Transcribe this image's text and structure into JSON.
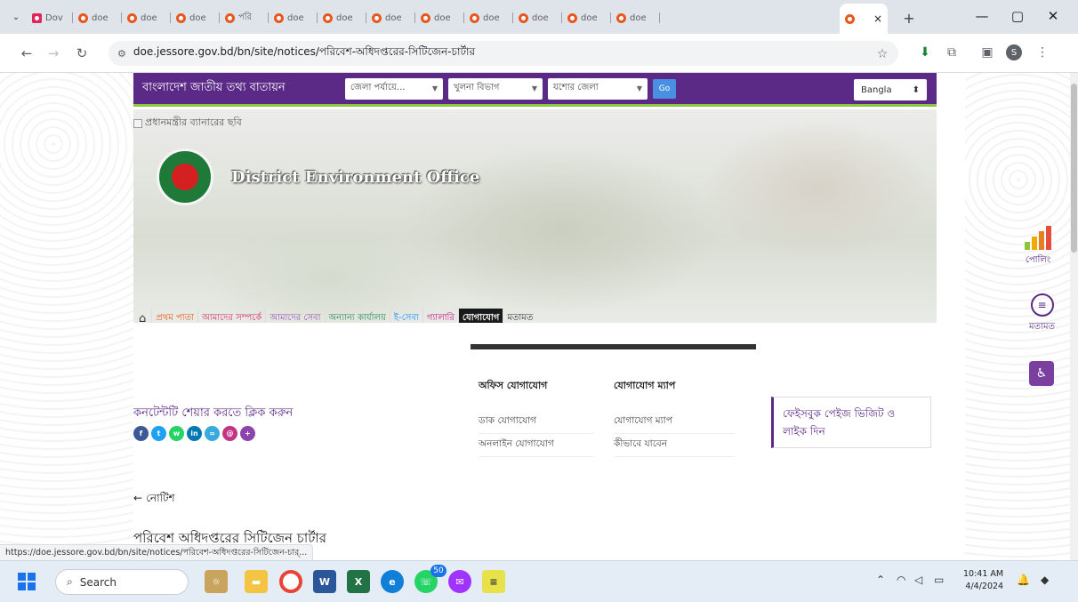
{
  "browser": {
    "tabs": [
      {
        "label": "Dov"
      },
      {
        "label": "doe"
      },
      {
        "label": "doe"
      },
      {
        "label": "doe"
      },
      {
        "label": "পরি"
      },
      {
        "label": "doe"
      },
      {
        "label": "doe"
      },
      {
        "label": "doe"
      },
      {
        "label": "doe"
      },
      {
        "label": "doe"
      },
      {
        "label": "doe"
      },
      {
        "label": "doe"
      },
      {
        "label": "doe"
      },
      {
        "label": ""
      }
    ],
    "close_tab": "×",
    "new_tab": "+",
    "url": "doe.jessore.gov.bd/bn/site/notices/পরিবেশ-অধিদপ্তরের-সিটিজেন-চার্টার",
    "status_url": "https://doe.jessore.gov.bd/bn/site/notices/পরিবেশ-অধিদপ্তরের-সিটিজেন-চার্..."
  },
  "site": {
    "portal_name": "বাংলাদেশ জাতীয় তথ্য বাতায়ন",
    "select_district_level": "জেলা পর্যায়ে...",
    "select_division": "খুলনা বিভাগ",
    "select_district": "যশোর জেলা",
    "go_label": "Go",
    "language": "Bangla",
    "banner_alt": "প্রধানমন্ত্রীর ব্যানারের ছবি",
    "office_name": "District Environment Office",
    "nav": {
      "home": "প্রথম পাতা",
      "about": "আমাদের সম্পর্কে",
      "services": "আমাদের সেবা",
      "offices": "অন্যান্য কার্যালয়",
      "eservice": "ই-সেবা",
      "gallery": "গ্যালারি",
      "contact": "যোগাযোগ",
      "opinion": "মতামত"
    },
    "contact_menu": {
      "office_contact_head": "অফিস যোগাযোগ",
      "map_head": "যোগাযোগ ম্যাপ",
      "postal": "ডাক যোগাযোগ",
      "online": "অনলাইন যোগাযোগ",
      "map_link": "যোগাযোগ ম্যাপ",
      "how_to_go": "কীভাবে যাবেন"
    },
    "share_text": "কনটেন্টটি শেয়ার করতে ক্লিক করুন",
    "facebook_box": "ফেইসবুক পেইজ ভিজিট ও লাইক দিন",
    "back_link": "নোটিশ",
    "notice_title": "পরিবেশ অধিদপ্তরের সিটিজেন চার্টার",
    "side": {
      "poll": "পোলিং",
      "feedback": "মতামত"
    },
    "colors": {
      "brand_purple": "#5b2a86",
      "accent_green": "#8cc63f",
      "nav_home": "#e8581e",
      "nav_about": "#d6336c",
      "nav_services": "#9b59b6",
      "nav_offices": "#2e8b57",
      "nav_eservice": "#1e90ff",
      "nav_gallery": "#c71585"
    }
  },
  "taskbar": {
    "search": "Search",
    "time": "10:41 AM",
    "date": "4/4/2024",
    "badge": "50"
  }
}
